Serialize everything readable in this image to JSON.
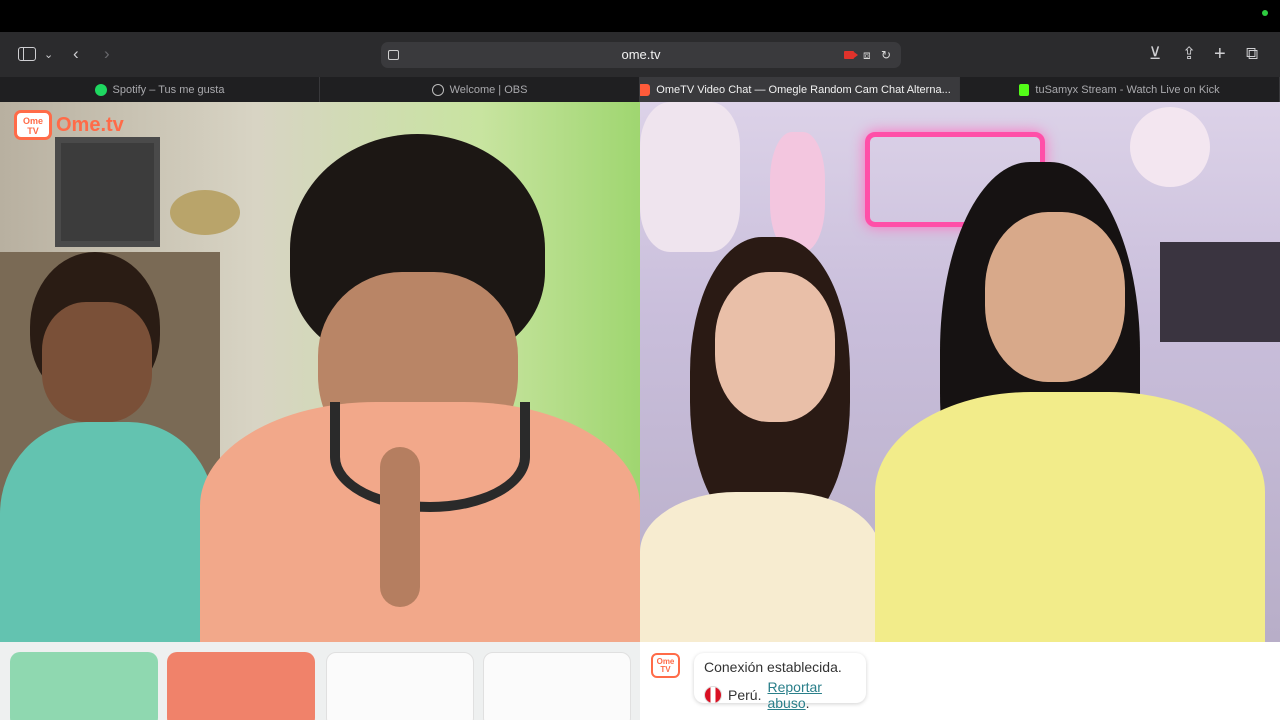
{
  "browser": {
    "url": "ome.tv",
    "tabs": [
      {
        "label": "Spotify – Tus me gusta",
        "icon": "spotify-icon",
        "active": false
      },
      {
        "label": "Welcome | OBS",
        "icon": "obs-icon",
        "active": false
      },
      {
        "label": "OmeTV Video Chat — Omegle Random Cam Chat Alterna...",
        "icon": "ometv-icon",
        "active": true
      },
      {
        "label": "tuSamyx Stream - Watch Live on Kick",
        "icon": "kick-icon",
        "active": false
      }
    ]
  },
  "ometv": {
    "logo_badge": "Ome TV",
    "logo_text": "Ome.tv"
  },
  "chat": {
    "avatar_badge": "Ome TV",
    "connection_message": "Conexión establecida.",
    "country": "Perú.",
    "report_link": "Reportar abuso",
    "report_suffix": "."
  },
  "colors": {
    "accent": "#ff6b48",
    "start_button": "#8fd8b0",
    "stop_button": "#f0826a",
    "link": "#2a7f8a"
  }
}
